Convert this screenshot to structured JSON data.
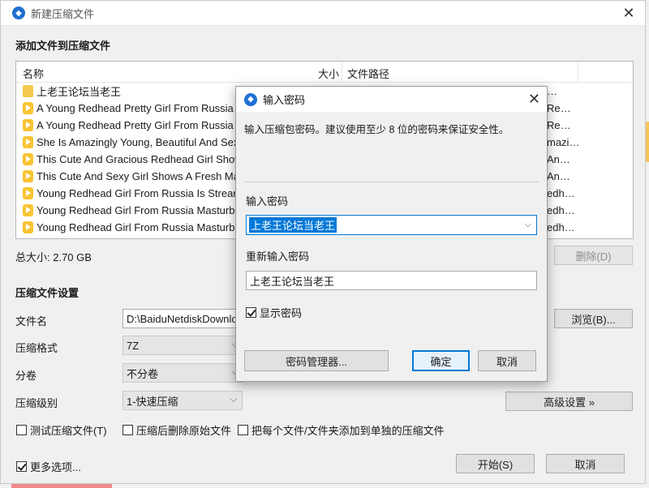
{
  "window": {
    "title": "新建压缩文件",
    "section_add": "添加文件到压缩文件",
    "columns": {
      "name": "名称",
      "size": "大小",
      "path": "文件路径"
    },
    "files": [
      {
        "type": "folder",
        "name": "上老王论坛当老王",
        "path": "…"
      },
      {
        "type": "video",
        "name": "A Young Redhead Pretty Girl From Russia",
        "path": "Re…"
      },
      {
        "type": "video",
        "name": "A Young Redhead Pretty Girl From Russia",
        "path": "Re…"
      },
      {
        "type": "video",
        "name": "She Is Amazingly Young, Beautiful And Sex",
        "path": "mazi…"
      },
      {
        "type": "video",
        "name": "This Cute And Gracious Redhead Girl Show",
        "path": "An…"
      },
      {
        "type": "video",
        "name": "This Cute And Sexy Girl Shows A Fresh Mar",
        "path": "An…"
      },
      {
        "type": "video",
        "name": "Young Redhead Girl From Russia Is Stream",
        "path": "edh…"
      },
      {
        "type": "video",
        "name": "Young Redhead Girl From Russia Masturba",
        "path": "edh…"
      },
      {
        "type": "video",
        "name": "Young Redhead Girl From Russia Masturba",
        "path": "edh…"
      }
    ],
    "total_size": "总大小: 2.70 GB",
    "delete_button": "删除(D)",
    "settings_title": "压缩文件设置",
    "filename_label": "文件名",
    "filename_value": "D:\\BaiduNetdiskDownlo",
    "browse_button": "浏览(B)...",
    "format_label": "压缩格式",
    "format_value": "7Z",
    "volume_label": "分卷",
    "volume_value": "不分卷",
    "level_label": "压缩级别",
    "level_value": "1-快速压缩",
    "advanced_button": "高级设置 »",
    "opt_test": "测试压缩文件(T)",
    "opt_delete_source": "压缩后删除原始文件",
    "opt_each_file": "把每个文件/文件夹添加到单独的压缩文件",
    "more_options": "更多选项...",
    "start_button": "开始(S)",
    "cancel_button": "取消"
  },
  "dialog": {
    "title": "输入密码",
    "message": "输入压缩包密码。建议使用至少 8 位的密码来保证安全性。",
    "password_label": "输入密码",
    "password_value": "上老王论坛当老王",
    "reenter_label": "重新输入密码",
    "reenter_value": "上老王论坛当老王",
    "show_password": "显示密码",
    "show_password_checked": true,
    "manager_button": "密码管理器...",
    "ok_button": "确定",
    "cancel_button": "取消"
  }
}
